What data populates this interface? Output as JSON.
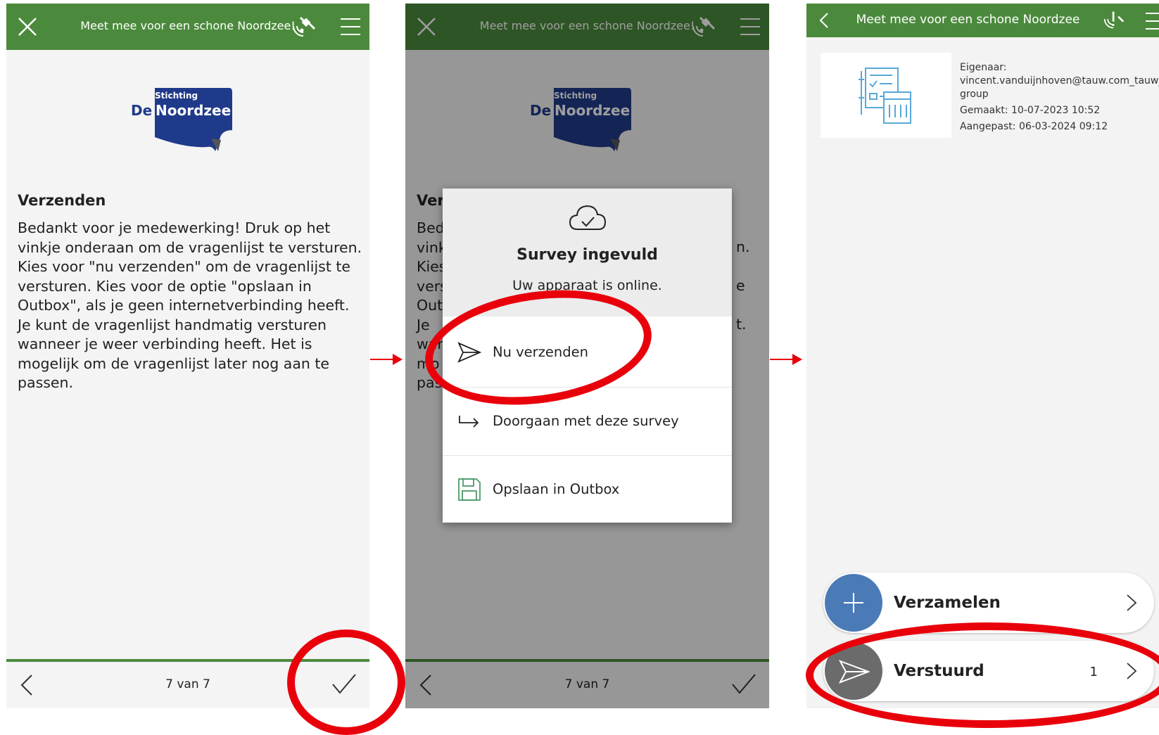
{
  "screen1": {
    "header_title": "Meet mee voor een schone Noordzee!",
    "logo": {
      "line1": "Stichting",
      "line2_a": "De",
      "line2_b": "Noordzee"
    },
    "heading": "Verzenden",
    "body": "Bedankt voor je medewerking! Druk op het vinkje onderaan om de vragenlijst te versturen. Kies voor \"nu verzenden\" om de vragenlijst te versturen. Kies voor de optie \"opslaan in Outbox\", als je geen internetverbinding heeft. Je kunt de vragenlijst handmatig versturen wanneer je weer verbinding heeft. Het is mogelijk om de vragenlijst later nog aan te passen.",
    "pager": "7 van 7"
  },
  "screen2": {
    "header_title": "Meet mee voor een schone Noordzee!",
    "pager": "7 van 7",
    "behind": {
      "heading_part": "Ver",
      "lines": [
        "Bed",
        "vink",
        "Kies",
        "vers",
        "Out",
        "Je",
        "war",
        "mo",
        "pas"
      ],
      "right_frags": [
        "n.",
        "e",
        "t."
      ]
    },
    "dialog": {
      "title": "Survey ingevuld",
      "subtitle": "Uw apparaat is online.",
      "options": [
        "Nu verzenden",
        "Doorgaan met deze survey",
        "Opslaan in Outbox"
      ]
    }
  },
  "screen3": {
    "header_title": "Meet mee voor een schone Noordzee",
    "meta": {
      "owner_label": "Eigenaar:",
      "owner_value": "vincent.vanduijnhoven@tauw.com_tauw_group",
      "created": "Gemaakt: 10-07-2023 10:52",
      "modified": "Aangepast: 06-03-2024 09:12"
    },
    "actions": [
      {
        "label": "Verzamelen",
        "count": "",
        "color": "#4a7bb7"
      },
      {
        "label": "Verstuurd",
        "count": "1",
        "color": "#6b6b6b"
      }
    ]
  },
  "colors": {
    "header": "#4b8a3c",
    "highlight": "#e8000b",
    "logo_blue": "#1f3a8a"
  }
}
